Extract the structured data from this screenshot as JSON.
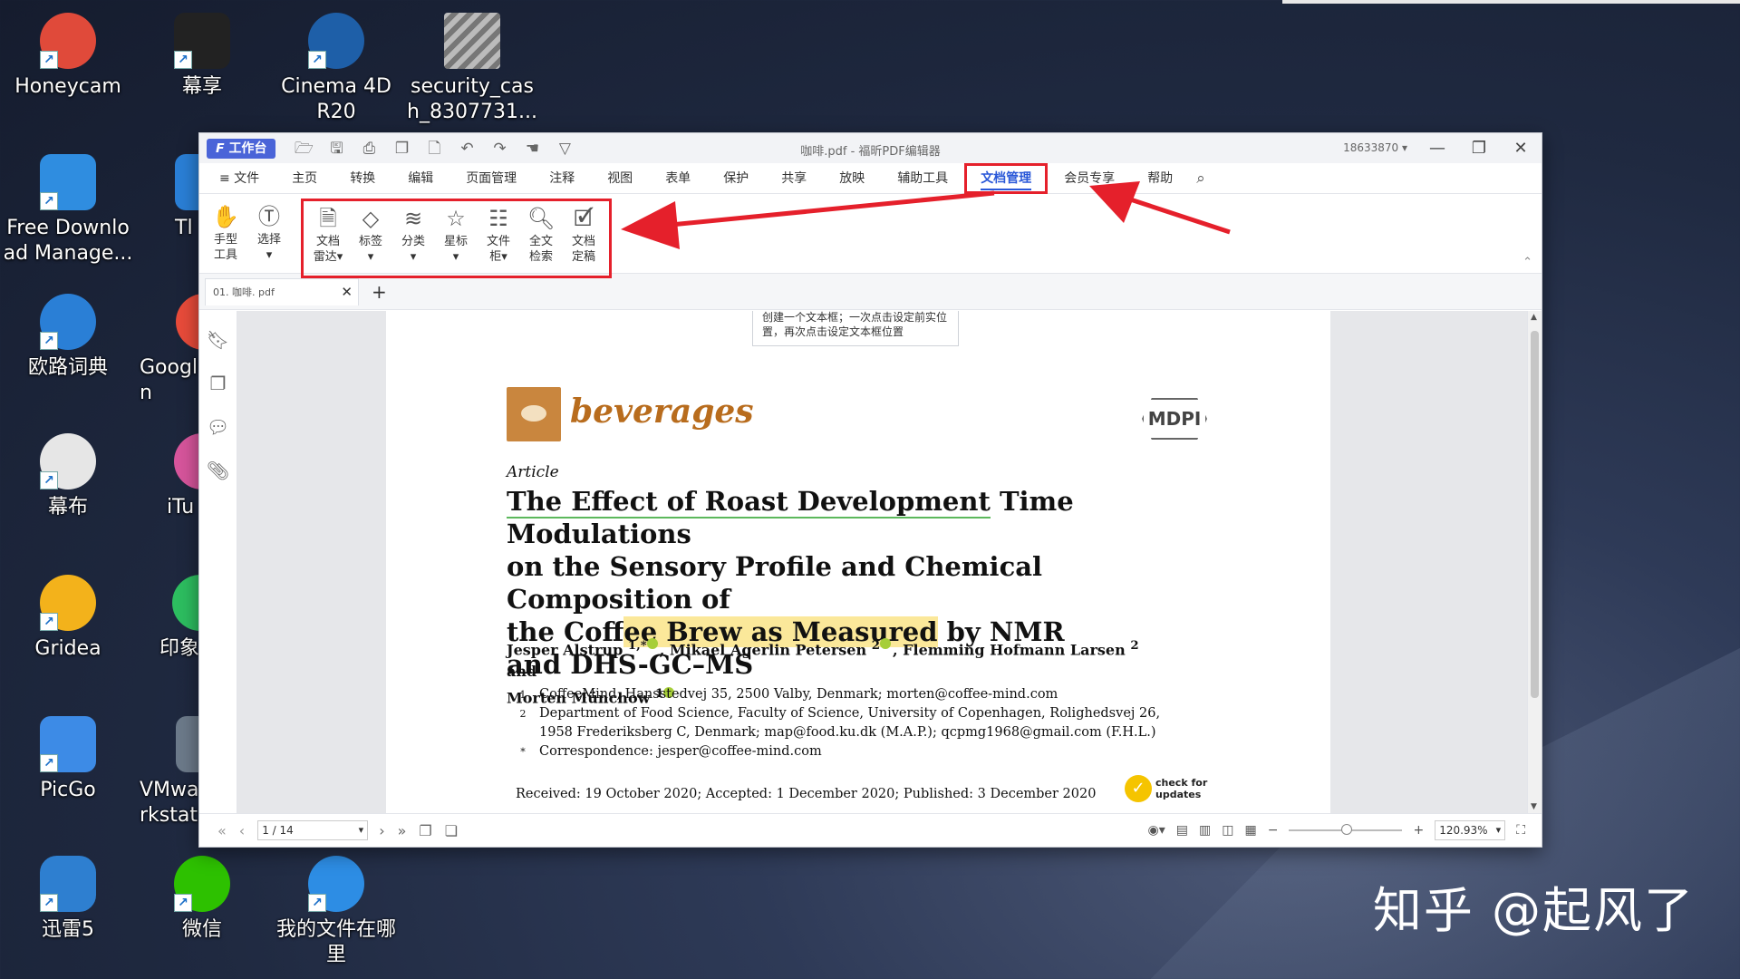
{
  "desktop": {
    "col1": [
      {
        "label": "Honeycam",
        "color": "#e04a3a"
      },
      {
        "label": "Free Downlo\nad Manage...",
        "color": "#2f8de0"
      },
      {
        "label": "欧路词典",
        "color": "#2a7fd6"
      },
      {
        "label": "幕布",
        "color": "#3a3a3a"
      },
      {
        "label": "Gridea",
        "color": "#f3b21b"
      },
      {
        "label": "PicGo",
        "color": "#3d8be6"
      },
      {
        "label": "迅雷5",
        "color": "#2e7fd0"
      }
    ],
    "col2": [
      {
        "label": "幕享",
        "color": "#222222"
      },
      {
        "label": "Tl",
        "color": "#2a7fd6"
      },
      {
        "label": "Googl\nn",
        "color": "#e84b3a"
      },
      {
        "label": "iTu",
        "color": "#d7559c"
      },
      {
        "label": "印象",
        "color": "#2dbe60"
      },
      {
        "label": "VMwa\nrkstati",
        "color": "#6c7a8a"
      },
      {
        "label": "微信",
        "color": "#2dc100"
      }
    ],
    "extra": [
      {
        "label": "Cinema 4D\nR20",
        "color": "#1e5fa8"
      },
      {
        "label": "security_cas\nh_8307731...",
        "color": "#8a8a8a"
      },
      {
        "label": "我的文件在哪\n里",
        "color": "#2d8de4"
      }
    ]
  },
  "window": {
    "workbench": "工作台",
    "title": "咖啡.pdf - 福昕PDF编辑器",
    "account": "18633870 ▾",
    "menu": [
      "≡ 文件",
      "主页",
      "转换",
      "编辑",
      "页面管理",
      "注释",
      "视图",
      "表单",
      "保护",
      "共享",
      "放映",
      "辅助工具",
      "文档管理",
      "会员专享",
      "帮助"
    ],
    "active_menu": "文档管理",
    "ribbon_left": [
      {
        "label1": "手型",
        "label2": "工具"
      },
      {
        "label1": "选择",
        "label2": "▾"
      }
    ],
    "ribbon_group": [
      {
        "label1": "文档",
        "label2": "雷达▾"
      },
      {
        "label1": "标签",
        "label2": "▾"
      },
      {
        "label1": "分类",
        "label2": "▾"
      },
      {
        "label1": "星标",
        "label2": "▾"
      },
      {
        "label1": "文件",
        "label2": "柜▾"
      },
      {
        "label1": "全文",
        "label2": "检索"
      },
      {
        "label1": "文档",
        "label2": "定稿"
      }
    ],
    "tab": {
      "name": "01. 咖啡. pdf"
    },
    "tooltip": "创建一个文本框；一次点击设定前实位置，再次点击设定文本框位置",
    "statusbar": {
      "page": "1 / 14",
      "zoom": "120.93%"
    }
  },
  "paper": {
    "journal": "beverages",
    "publisher": "MDPI",
    "article_type": "Article",
    "title_part1": "The Effect of Roast Development",
    "title_part2": " Time Modulations",
    "title_line2": "on the Sensory Profile and Chemical Composition of",
    "title_line3a": "the Cof",
    "title_line3b": "fee Brew as Measured",
    "title_line3c": " by NMR",
    "title_line4": "and DHS-GC–MS",
    "author1": "Jesper Alstrup",
    "author1_sup": "1,*",
    "author2": ", Mikael Agerlin Petersen",
    "author2_sup": "2",
    "author3": ", Flemming Hofmann Larsen",
    "author3_sup": "2",
    "authors_and": " and",
    "author4": "Morten Münchow",
    "author4_sup": "1",
    "affiliations": [
      {
        "n": "1",
        "text": "CoffeeMind, Hansstedvej 35, 2500 Valby, Denmark; morten@coffee-mind.com"
      },
      {
        "n": "2",
        "text": "Department of Food Science, Faculty of Science, University of Copenhagen, Rolighedsvej 26,"
      },
      {
        "n": "",
        "text": "1958 Frederiksberg C, Denmark; map@food.ku.dk (M.A.P.); qcpmg1968@gmail.com (F.H.L.)"
      },
      {
        "n": "*",
        "text": "Correspondence: jesper@coffee-mind.com"
      }
    ],
    "received": "Received: 19 October 2020; Accepted: 1 December 2020; Published: 3 December 2020",
    "check_updates_1": "check for",
    "check_updates_2": "updates"
  },
  "watermark": "知乎 @起风了",
  "colors": {
    "accent": "#2a58d8",
    "annotation_red": "#e5202b"
  }
}
